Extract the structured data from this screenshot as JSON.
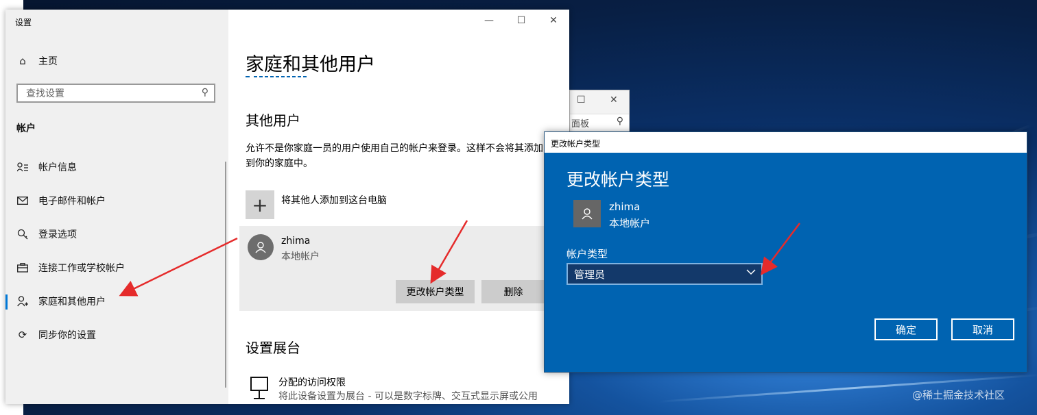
{
  "settings_window": {
    "title": "设置",
    "controls": {
      "minimize": "—",
      "maximize": "☐",
      "close": "✕"
    }
  },
  "sidebar": {
    "home_label": "主页",
    "search": {
      "placeholder": "查找设置"
    },
    "section_label": "帐户",
    "items": [
      {
        "label": "帐户信息",
        "icon": "person-list-icon"
      },
      {
        "label": "电子邮件和帐户",
        "icon": "mail-icon"
      },
      {
        "label": "登录选项",
        "icon": "key-icon"
      },
      {
        "label": "连接工作或学校帐户",
        "icon": "briefcase-icon"
      },
      {
        "label": "家庭和其他用户",
        "icon": "person-add-icon",
        "active": true
      },
      {
        "label": "同步你的设置",
        "icon": "sync-icon"
      }
    ]
  },
  "main": {
    "title": "家庭和其他用户",
    "other_users_heading": "其他用户",
    "description": "允许不是你家庭一员的用户使用自己的帐户来登录。这样不会将其添加到你的家庭中。",
    "add_user_label": "将其他人添加到这台电脑",
    "user": {
      "name": "zhima",
      "account_type": "本地帐户",
      "change_type_label": "更改帐户类型",
      "delete_label": "删除"
    },
    "kiosk_heading": "设置展台",
    "kiosk_title": "分配的访问权限",
    "kiosk_description": "将此设备设置为展台 - 可以是数字标牌、交互式显示屏或公用"
  },
  "background_window": {
    "search_text": "面板"
  },
  "dialog": {
    "title": "更改帐户类型",
    "heading": "更改帐户类型",
    "user_name": "zhima",
    "user_account_type": "本地帐户",
    "account_type_label": "帐户类型",
    "selected_type": "管理员",
    "ok_label": "确定",
    "cancel_label": "取消"
  },
  "watermark": "@稀土掘金技术社区",
  "colors": {
    "accent_blue": "#0063b1",
    "arrow_red": "#e52b2b",
    "nav_active": "#0078d7"
  }
}
